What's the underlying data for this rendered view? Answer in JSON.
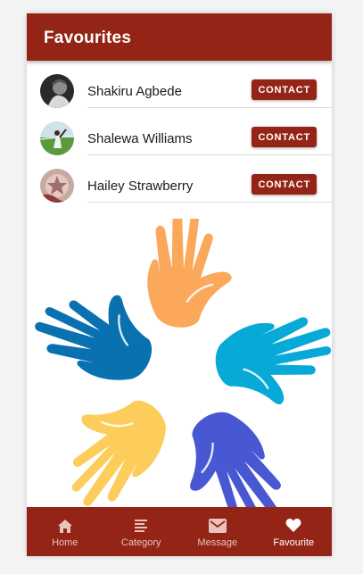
{
  "appbar": {
    "title": "Favourites"
  },
  "favourites": [
    {
      "name": "Shakiru Agbede",
      "action": "CONTACT"
    },
    {
      "name": "Shalewa Williams",
      "action": "CONTACT"
    },
    {
      "name": "Hailey Strawberry",
      "action": "CONTACT"
    }
  ],
  "hero": {
    "hands": [
      {
        "color": "#fba85a"
      },
      {
        "color": "#07a9d7"
      },
      {
        "color": "#4857d2"
      },
      {
        "color": "#fdcd5b"
      },
      {
        "color": "#0a71b0"
      }
    ]
  },
  "bottom_nav": [
    {
      "label": "Home",
      "icon": "home-icon"
    },
    {
      "label": "Category",
      "icon": "category-icon"
    },
    {
      "label": "Message",
      "icon": "mail-icon"
    },
    {
      "label": "Favourite",
      "icon": "heart-icon",
      "active": true
    }
  ],
  "colors": {
    "primary": "#942415",
    "background": "#ffffff"
  }
}
